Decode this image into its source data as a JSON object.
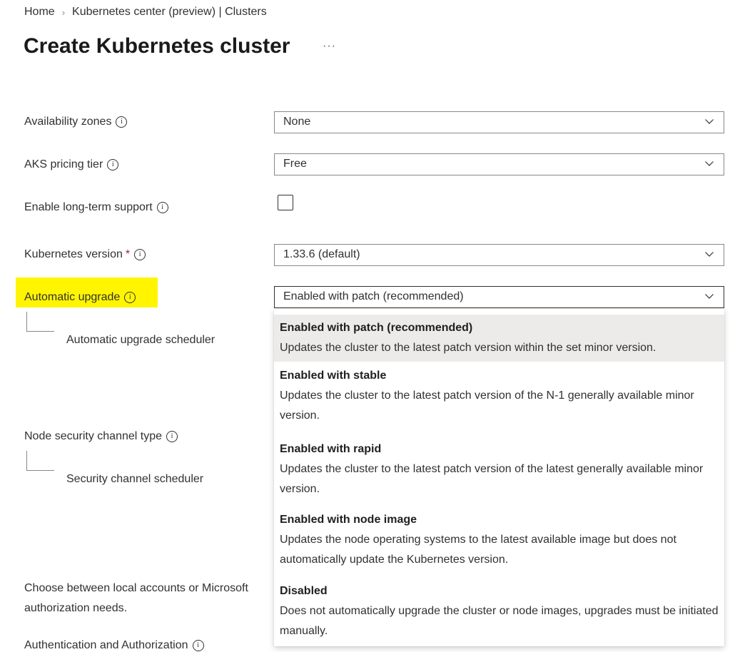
{
  "breadcrumb": {
    "home": "Home",
    "separator": "›",
    "current": "Kubernetes center (preview) | Clusters"
  },
  "page": {
    "title": "Create Kubernetes cluster",
    "more": "···"
  },
  "fields": {
    "availability_zones": {
      "label": "Availability zones",
      "value": "None"
    },
    "pricing_tier": {
      "label": "AKS pricing tier",
      "value": "Free"
    },
    "lts": {
      "label": "Enable long-term support",
      "checked": false
    },
    "k8s_version": {
      "label": "Kubernetes version",
      "required_mark": "*",
      "value": "1.33.6 (default)"
    },
    "auto_upgrade": {
      "label": "Automatic upgrade",
      "value": "Enabled with patch (recommended)"
    },
    "auto_upgrade_scheduler": {
      "label": "Automatic upgrade scheduler"
    },
    "node_security": {
      "label": "Node security channel type"
    },
    "security_scheduler": {
      "label": "Security channel scheduler"
    },
    "auth_desc": {
      "line1": "Choose between local accounts or Microsoft",
      "line2": "authorization needs."
    },
    "auth": {
      "label": "Authentication and Authorization"
    }
  },
  "info_glyph": "i",
  "dropdown": {
    "options": [
      {
        "title": "Enabled with patch (recommended)",
        "desc": "Updates the cluster to the latest patch version within the set minor version.",
        "selected": true
      },
      {
        "title": "Enabled with stable",
        "desc": "Updates the cluster to the latest patch version of the N-1 generally available minor version.",
        "selected": false
      },
      {
        "title": "Enabled with rapid",
        "desc": "Updates the cluster to the latest patch version of the latest generally available minor version.",
        "selected": false
      },
      {
        "title": "Enabled with node image",
        "desc": "Updates the node operating systems to the latest available image but does not automatically update the Kubernetes version.",
        "selected": false
      },
      {
        "title": "Disabled",
        "desc": "Does not automatically upgrade the cluster or node images, upgrades must be initiated manually.",
        "selected": false
      }
    ]
  },
  "colors": {
    "highlight": "#fff500",
    "selected_option_bg": "#edebe9",
    "required": "#a4262c"
  }
}
